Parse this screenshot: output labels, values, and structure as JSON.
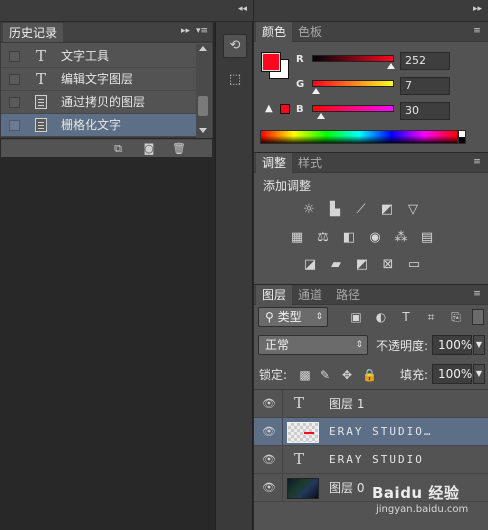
{
  "history": {
    "tab_label": "历史记录",
    "items": [
      {
        "icon": "text-tool-icon",
        "label": "文字工具",
        "selected": false
      },
      {
        "icon": "text-tool-icon",
        "label": "编辑文字图层",
        "selected": false
      },
      {
        "icon": "document-icon",
        "label": "通过拷贝的图层",
        "selected": false
      },
      {
        "icon": "document-icon",
        "label": "栅格化文字",
        "selected": true
      }
    ],
    "footer_icons": [
      "new-document-from-state-icon",
      "camera-icon",
      "trash-icon"
    ]
  },
  "color": {
    "tab_active": "颜色",
    "tab_inactive": "色板",
    "foreground": "#fc071e",
    "background": "#ffffff",
    "r_label": "R",
    "g_label": "G",
    "b_label": "B",
    "r_value": "252",
    "g_value": "7",
    "b_value": "30"
  },
  "adjustments": {
    "tab_active": "调整",
    "tab_inactive": "样式",
    "title": "添加调整",
    "row1": [
      "brightness-icon",
      "levels-icon",
      "curves-icon",
      "exposure-icon",
      "vibrance-icon"
    ],
    "row2": [
      "hue-saturation-icon",
      "color-balance-icon",
      "black-white-icon",
      "photo-filter-icon",
      "channel-mixer-icon",
      "color-lookup-icon"
    ],
    "row3": [
      "invert-icon",
      "posterize-icon",
      "threshold-icon",
      "selective-color-icon",
      "gradient-map-icon"
    ]
  },
  "layers": {
    "tab_active": "图层",
    "tab_2": "通道",
    "tab_3": "路径",
    "filter_kind": "类型",
    "blend_mode": "正常",
    "opacity_label": "不透明度:",
    "opacity_value": "100%",
    "lock_label": "锁定:",
    "fill_label": "填充:",
    "fill_value": "100%",
    "items": [
      {
        "type": "text",
        "name": "图层 1",
        "selected": false
      },
      {
        "type": "raster",
        "name": "ERAY  STUDIO…",
        "selected": true
      },
      {
        "type": "text",
        "name": "ERAY  STUDIO",
        "selected": false
      },
      {
        "type": "image",
        "name": "图层 0",
        "selected": false
      }
    ]
  },
  "watermark": {
    "text": "Baidu 经验",
    "url": "jingyan.baidu.com"
  }
}
